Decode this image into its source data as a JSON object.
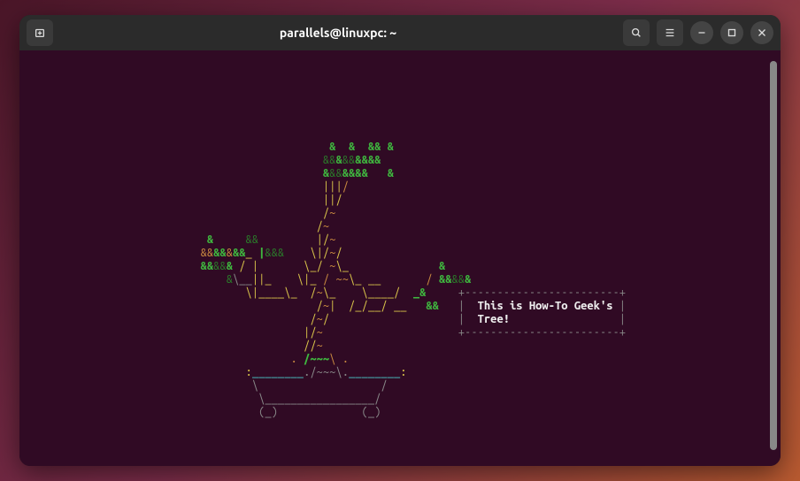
{
  "window": {
    "title": "parallels@linuxpc: ~"
  },
  "icons": {
    "new_tab": "new-tab-icon",
    "search": "search-icon",
    "menu": "hamburger-icon",
    "minimize": "minimize-icon",
    "maximize": "maximize-icon",
    "close": "close-icon"
  },
  "message_box": {
    "line1": "This is How-To Geek's",
    "line2": "Tree!"
  },
  "bonsai": {
    "lines": [
      [
        {
          "c": "g",
          "t": "                                               &  &  && &"
        }
      ],
      [
        {
          "c": "g",
          "t": "                                              "
        },
        {
          "c": "dg",
          "t": "&&"
        },
        {
          "c": "g",
          "t": "&"
        },
        {
          "c": "dg",
          "t": "&&"
        },
        {
          "c": "g",
          "t": "&&&&"
        }
      ],
      [
        {
          "c": "g",
          "t": "                                              &"
        },
        {
          "c": "dg",
          "t": "&&"
        },
        {
          "c": "g",
          "t": "&&&&   &"
        }
      ],
      [
        {
          "c": "y",
          "t": "                                              |||"
        },
        {
          "c": "o",
          "t": "/"
        }
      ],
      [
        {
          "c": "y",
          "t": "                                              ||/"
        }
      ],
      [
        {
          "c": "y",
          "t": "                                              /"
        },
        {
          "c": "o",
          "t": "~"
        }
      ],
      [
        {
          "c": "y",
          "t": "                                             /"
        },
        {
          "c": "o",
          "t": "~"
        }
      ],
      [
        {
          "c": "g",
          "t": "                            &     "
        },
        {
          "c": "dg",
          "t": "&&"
        },
        {
          "c": "y",
          "t": "         |/"
        },
        {
          "c": "o",
          "t": "~"
        }
      ],
      [
        {
          "c": "g",
          "t": "                           "
        },
        {
          "c": "o",
          "t": "&&"
        },
        {
          "c": "g",
          "t": "&&"
        },
        {
          "c": "o",
          "t": "&"
        },
        {
          "c": "g",
          "t": "&&"
        },
        {
          "c": "y",
          "t": "_ "
        },
        {
          "c": "g",
          "t": "|"
        },
        {
          "c": "dg",
          "t": "&&&"
        },
        {
          "c": "y",
          "t": "    \\|/"
        },
        {
          "c": "o",
          "t": "~"
        },
        {
          "c": "y",
          "t": "/"
        }
      ],
      [
        {
          "c": "g",
          "t": "                           &&"
        },
        {
          "c": "dg",
          "t": "&&"
        },
        {
          "c": "g",
          "t": "& "
        },
        {
          "c": "y",
          "t": "/ |       \\_/ "
        },
        {
          "c": "o",
          "t": "~"
        },
        {
          "c": "y",
          "t": "\\_              "
        },
        {
          "c": "g",
          "t": "&"
        }
      ],
      [
        {
          "c": "g",
          "t": "                               "
        },
        {
          "c": "dg",
          "t": "&"
        },
        {
          "c": "gr",
          "t": "\\__"
        },
        {
          "c": "y",
          "t": "||_    \\|_"
        },
        {
          "c": "o",
          "t": " / "
        },
        {
          "c": "o",
          "t": "~~"
        },
        {
          "c": "y",
          "t": "\\_ __       "
        },
        {
          "c": "o",
          "t": "/ "
        },
        {
          "c": "g",
          "t": "&&"
        },
        {
          "c": "dg",
          "t": "&&"
        },
        {
          "c": "g",
          "t": "&"
        }
      ],
      [
        {
          "c": "y",
          "t": "                                  \\|____\\_"
        },
        {
          "c": "gr",
          "t": "  "
        },
        {
          "c": "y",
          "t": "/"
        },
        {
          "c": "o",
          "t": "~"
        },
        {
          "c": "y",
          "t": "\\_    \\____/  "
        },
        {
          "c": "g",
          "t": "_&     "
        },
        {
          "c": "gr",
          "t": "+------------------------+"
        }
      ],
      [
        {
          "c": "y",
          "t": "                                             /"
        },
        {
          "c": "o",
          "t": "~"
        },
        {
          "c": "y",
          "t": "|  /_/__/ __   "
        },
        {
          "c": "g",
          "t": "&&   "
        },
        {
          "c": "gr",
          "t": "|  "
        },
        {
          "c": "w",
          "t": "This is How-To Geek's"
        },
        {
          "c": "gr",
          "t": " |"
        }
      ],
      [
        {
          "c": "y",
          "t": "                                            /"
        },
        {
          "c": "o",
          "t": "~"
        },
        {
          "c": "y",
          "t": "/                    "
        },
        {
          "c": "gr",
          "t": "|  "
        },
        {
          "c": "w",
          "t": "Tree!"
        },
        {
          "c": "gr",
          "t": "                 |"
        }
      ],
      [
        {
          "c": "y",
          "t": "                                           |/"
        },
        {
          "c": "o",
          "t": "~"
        },
        {
          "c": "y",
          "t": "                     "
        },
        {
          "c": "gr",
          "t": "+------------------------+"
        }
      ],
      [
        {
          "c": "y",
          "t": "                                           //"
        },
        {
          "c": "o",
          "t": "~"
        }
      ],
      [
        {
          "c": "o",
          "t": "                                         . "
        },
        {
          "c": "g",
          "t": "/~~~"
        },
        {
          "c": "o",
          "t": "\\ ."
        }
      ],
      [
        {
          "c": "gr",
          "t": "                                  "
        },
        {
          "c": "y",
          "t": ":"
        },
        {
          "c": "c",
          "t": "________"
        },
        {
          "c": "gr",
          "t": "./~~~\\."
        },
        {
          "c": "c",
          "t": "________"
        },
        {
          "c": "y",
          "t": ":"
        }
      ],
      [
        {
          "c": "gr",
          "t": "                                   \\                   /"
        }
      ],
      [
        {
          "c": "gr",
          "t": "                                    \\_________________/"
        }
      ],
      [
        {
          "c": "gr",
          "t": "                                    (_)             (_)"
        }
      ]
    ]
  }
}
